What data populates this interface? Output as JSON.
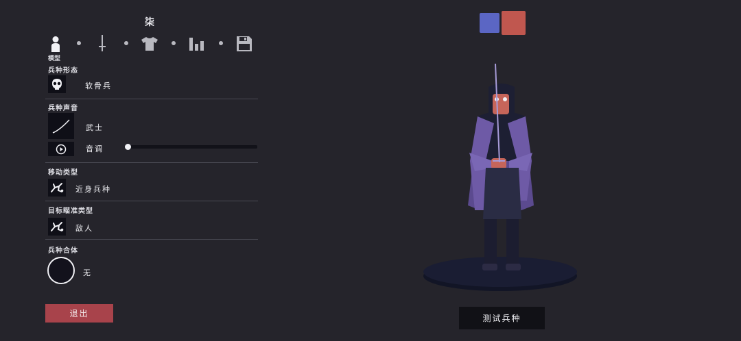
{
  "unit": {
    "name": "柒"
  },
  "tabs": [
    {
      "id": "model",
      "label": "模型",
      "icon": "person-icon",
      "active": true
    },
    {
      "id": "weapons",
      "label": "",
      "icon": "sword-icon"
    },
    {
      "id": "clothing",
      "label": "",
      "icon": "shirt-icon"
    },
    {
      "id": "stats",
      "label": "",
      "icon": "bar-chart-icon"
    },
    {
      "id": "save",
      "label": "",
      "icon": "floppy-disk-icon"
    }
  ],
  "sections": {
    "unit_base": {
      "title": "兵种形态",
      "value": "软骨兵",
      "icon": "skull-mask-icon"
    },
    "unit_voice": {
      "title": "兵种声音",
      "value": "武士",
      "icon": "voice-curve-icon",
      "pitch_label": "音调",
      "pitch_value": 0.0,
      "play_icon": "play-icon"
    },
    "movement_type": {
      "title": "移动类型",
      "value": "近身兵种",
      "icon": "movement-icon"
    },
    "target_type": {
      "title": "目标瞄准类型",
      "value": "敌人",
      "icon": "target-icon"
    },
    "unit_combine": {
      "title": "兵种合体",
      "value": "无",
      "icon": "empty-circle-icon"
    }
  },
  "buttons": {
    "exit_label": "退出",
    "test_label": "测试兵种"
  },
  "team_colors": {
    "blue": "#5b66c4",
    "red": "#c0574f"
  },
  "colors": {
    "background": "#25242b",
    "accent_exit": "#a8434b",
    "platform": "#171a2c"
  }
}
